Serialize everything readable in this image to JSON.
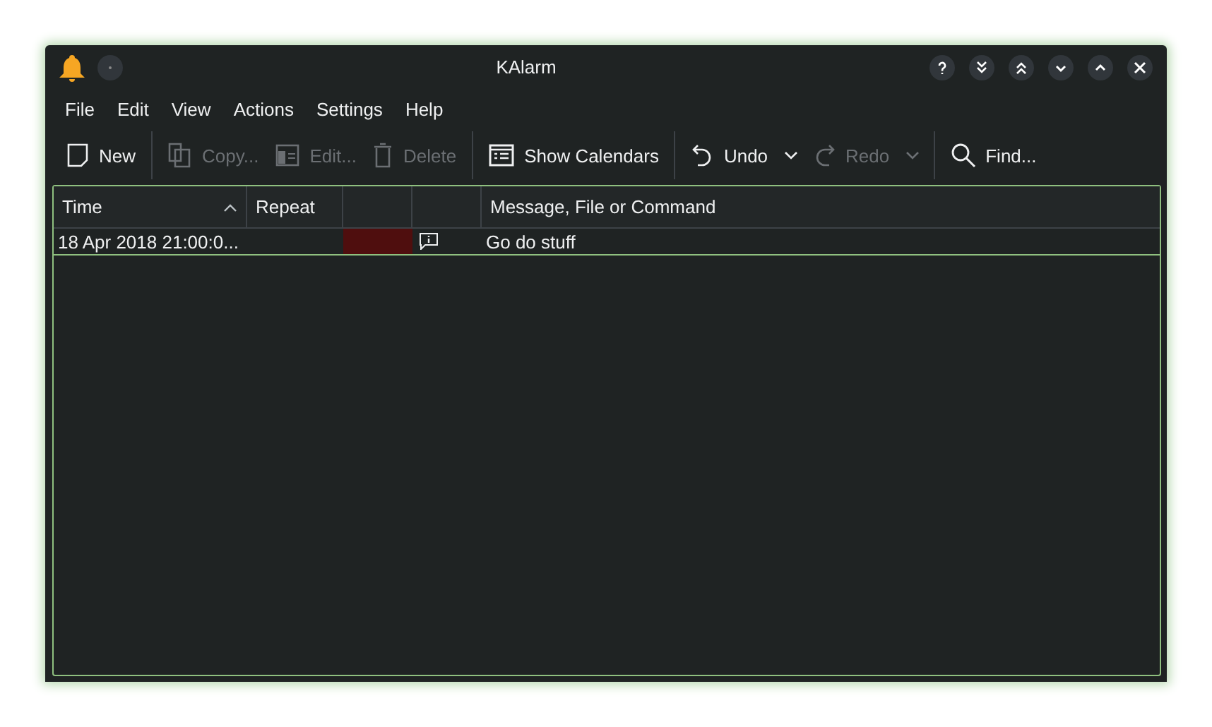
{
  "window": {
    "title": "KAlarm"
  },
  "menu": [
    "File",
    "Edit",
    "View",
    "Actions",
    "Settings",
    "Help"
  ],
  "toolbar": [
    {
      "kind": "new",
      "label": "New",
      "disabled": false,
      "menu": false
    },
    {
      "kind": "separator"
    },
    {
      "kind": "copy",
      "label": "Copy...",
      "disabled": true,
      "menu": false
    },
    {
      "kind": "edit",
      "label": "Edit...",
      "disabled": true,
      "menu": false
    },
    {
      "kind": "delete",
      "label": "Delete",
      "disabled": true,
      "menu": false
    },
    {
      "kind": "separator"
    },
    {
      "kind": "calendars",
      "label": "Show Calendars",
      "disabled": false,
      "menu": false
    },
    {
      "kind": "separator"
    },
    {
      "kind": "undo",
      "label": "Undo",
      "disabled": false,
      "menu": true
    },
    {
      "kind": "redo",
      "label": "Redo",
      "disabled": true,
      "menu": true
    },
    {
      "kind": "separator"
    },
    {
      "kind": "find",
      "label": "Find...",
      "disabled": false,
      "menu": false
    }
  ],
  "table": {
    "columns": [
      {
        "label": "Time",
        "sorted": true
      },
      {
        "label": "Repeat",
        "sorted": false
      },
      {
        "sorted": false
      },
      {
        "sorted": false
      },
      {
        "label": "Message, File or Command",
        "sorted": false
      }
    ],
    "rows": [
      {
        "time": "18 Apr 2018 21:00:0...",
        "color": "#4f0e0e",
        "kind": "message",
        "message": "Go do stuff",
        "selected": false
      }
    ]
  }
}
